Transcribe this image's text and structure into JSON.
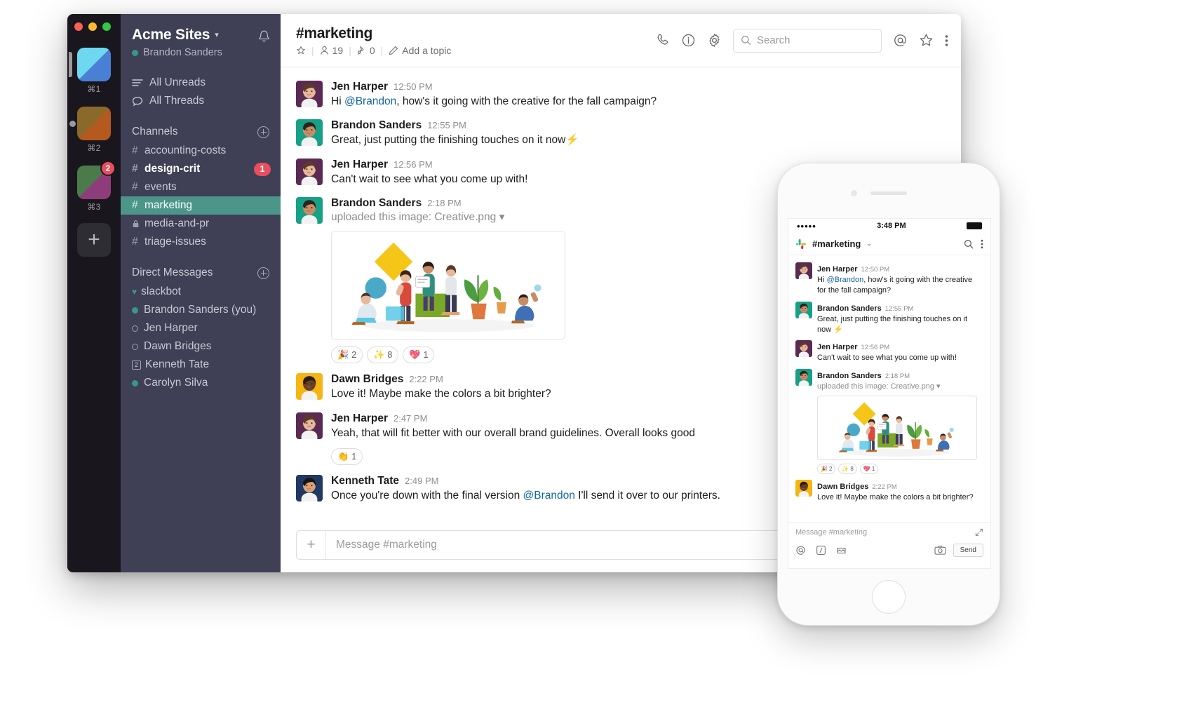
{
  "desktop": {
    "rail": {
      "workspaces": [
        {
          "key": "⌘1",
          "name": "workspace-acme-sites",
          "badge": null,
          "active": true
        },
        {
          "key": "⌘2",
          "name": "workspace-two",
          "badge": null,
          "active": false
        },
        {
          "key": "⌘3",
          "name": "workspace-three",
          "badge": "2",
          "active": false
        }
      ],
      "add_label": "+"
    },
    "sidebar": {
      "workspace_name": "Acme Sites",
      "caret": "▾",
      "user_name": "Brandon Sanders",
      "bell_icon": "notifications-bell-icon",
      "links": [
        {
          "label": "All Unreads",
          "icon": "unreads-icon"
        },
        {
          "label": "All Threads",
          "icon": "threads-icon"
        }
      ],
      "channels_title": "Channels",
      "channels": [
        {
          "prefix": "#",
          "label": "accounting-costs",
          "bold": false,
          "active": false,
          "badge": null
        },
        {
          "prefix": "#",
          "label": "design-crit",
          "bold": true,
          "active": false,
          "badge": "1"
        },
        {
          "prefix": "#",
          "label": "events",
          "bold": false,
          "active": false,
          "badge": null
        },
        {
          "prefix": "#",
          "label": "marketing",
          "bold": false,
          "active": true,
          "badge": null
        },
        {
          "prefix": "lock",
          "label": "media-and-pr",
          "bold": false,
          "active": false,
          "badge": null
        },
        {
          "prefix": "#",
          "label": "triage-issues",
          "bold": false,
          "active": false,
          "badge": null
        }
      ],
      "dms_title": "Direct Messages",
      "dms": [
        {
          "label": "slackbot",
          "status": "heart"
        },
        {
          "label": "Brandon Sanders (you)",
          "status": "online"
        },
        {
          "label": "Jen Harper",
          "status": "away"
        },
        {
          "label": "Dawn Bridges",
          "status": "away"
        },
        {
          "label": "Kenneth Tate",
          "status": "box"
        },
        {
          "label": "Carolyn Silva",
          "status": "online"
        }
      ]
    },
    "topbar": {
      "channel_title": "#marketing",
      "star_icon": "star-icon",
      "members_count": "19",
      "pins_count": "0",
      "topic_label": "Add a topic",
      "call_icon": "phone-icon",
      "info_icon": "info-icon",
      "settings_icon": "gear-icon",
      "search_placeholder": "Search",
      "mentions_icon": "at-mentions-icon",
      "starred_icon": "star-outline-icon",
      "more_icon": "more-vertical-icon"
    },
    "messages": [
      {
        "author": "Jen Harper",
        "time": "12:50 PM",
        "avatar": "jen",
        "parts": [
          {
            "t": "text",
            "v": "Hi "
          },
          {
            "t": "mention",
            "v": "@Brandon"
          },
          {
            "t": "text",
            "v": ", how's it going with the creative for the fall campaign?"
          }
        ]
      },
      {
        "author": "Brandon Sanders",
        "time": "12:55 PM",
        "avatar": "brandon",
        "parts": [
          {
            "t": "text",
            "v": "Great, just putting the finishing touches on it now"
          },
          {
            "t": "emoji",
            "v": "⚡"
          }
        ]
      },
      {
        "author": "Jen Harper",
        "time": "12:56 PM",
        "avatar": "jen",
        "parts": [
          {
            "t": "text",
            "v": "Can't wait to see what you come up with!"
          }
        ]
      },
      {
        "author": "Brandon Sanders",
        "time": "2:18 PM",
        "avatar": "brandon",
        "upload_prefix": "uploaded this image: ",
        "upload_file": "Creative.png",
        "upload_caret": "▾",
        "has_image": true,
        "reactions": [
          {
            "emoji": "🎉",
            "count": "2"
          },
          {
            "emoji": "✨",
            "count": "8"
          },
          {
            "emoji": "💖",
            "count": "1"
          }
        ]
      },
      {
        "author": "Dawn Bridges",
        "time": "2:22 PM",
        "avatar": "dawn",
        "parts": [
          {
            "t": "text",
            "v": "Love it! Maybe make the colors a bit brighter?"
          }
        ]
      },
      {
        "author": "Jen Harper",
        "time": "2:47 PM",
        "avatar": "jen",
        "parts": [
          {
            "t": "text",
            "v": "Yeah, that will fit better with our overall brand guidelines. Overall looks good"
          }
        ],
        "reactions": [
          {
            "emoji": "👏",
            "count": "1"
          }
        ]
      },
      {
        "author": "Kenneth Tate",
        "time": "2:49 PM",
        "avatar": "kenneth",
        "parts": [
          {
            "t": "text",
            "v": "Once you're down with the final version "
          },
          {
            "t": "mention",
            "v": "@Brandon"
          },
          {
            "t": "text",
            "v": " I'll send it over to our printers."
          }
        ]
      }
    ],
    "composer": {
      "plus_label": "+",
      "placeholder": "Message #marketing"
    }
  },
  "phone": {
    "status": {
      "signal": "•••••",
      "time": "3:48 PM",
      "battery": "battery-icon"
    },
    "header": {
      "logo_icon": "slack-logo-icon",
      "channel": "#marketing",
      "caret": "⌄",
      "search_icon": "search-icon",
      "more_icon": "more-vertical-icon"
    },
    "messages": [
      {
        "author": "Jen Harper",
        "time": "12:50 PM",
        "avatar": "jen",
        "parts": [
          {
            "t": "text",
            "v": "Hi "
          },
          {
            "t": "mention",
            "v": "@Brandon"
          },
          {
            "t": "text",
            "v": ", how's it going with the creative for the fall campaign?"
          }
        ]
      },
      {
        "author": "Brandon Sanders",
        "time": "12:55 PM",
        "avatar": "brandon",
        "parts": [
          {
            "t": "text",
            "v": "Great, just putting the finishing touches on it now "
          },
          {
            "t": "emoji",
            "v": "⚡"
          }
        ]
      },
      {
        "author": "Jen Harper",
        "time": "12:56 PM",
        "avatar": "jen",
        "parts": [
          {
            "t": "text",
            "v": "Can't wait to see what you come up with!"
          }
        ]
      },
      {
        "author": "Brandon Sanders",
        "time": "2:18 PM",
        "avatar": "brandon",
        "upload_prefix": "uploaded this image: ",
        "upload_file": "Creative.png",
        "upload_caret": "▾",
        "has_image": true,
        "reactions": [
          {
            "emoji": "🎉",
            "count": "2"
          },
          {
            "emoji": "✨",
            "count": "8"
          },
          {
            "emoji": "💖",
            "count": "1"
          }
        ]
      },
      {
        "author": "Dawn Bridges",
        "time": "2:22 PM",
        "avatar": "dawn",
        "parts": [
          {
            "t": "text",
            "v": "Love it! Maybe make the colors a bit brighter?"
          }
        ]
      }
    ],
    "footer": {
      "placeholder": "Message #marketing",
      "expand_icon": "expand-icon",
      "mention_icon": "at-icon",
      "format_icon": "slash-icon",
      "attach_icon": "attachment-icon",
      "camera_icon": "camera-icon",
      "send_label": "Send"
    }
  },
  "colors": {
    "sidebar_bg": "#3f3f55",
    "rail_bg": "#19171d",
    "active_channel": "#4c9689",
    "badge_red": "#eb4d5c",
    "mention_blue": "#1264a3",
    "presence_green": "#38978d"
  }
}
